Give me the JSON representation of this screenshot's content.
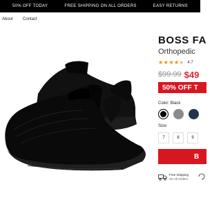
{
  "promo_bar": {
    "items": [
      "50% OFF TODAY",
      "FREE SHIPPING ON ALL ORDERS",
      "EASY RETURNS"
    ]
  },
  "nav": {
    "about": "About",
    "contact": "Contact"
  },
  "product": {
    "title": "BOSS FA",
    "subtitle": "Orthopedic",
    "rating": "4.7",
    "rating_stars": 4.5,
    "old_price": "$99.99",
    "new_price": "$49",
    "discount_badge": "50% OFF T",
    "color_label": "Color: Black",
    "colors": [
      {
        "name": "Black",
        "hex": "#000000"
      },
      {
        "name": "Grey",
        "hex": "#8a8a8a"
      },
      {
        "name": "Navy",
        "hex": "#25354f"
      }
    ],
    "size_label": "Size:",
    "sizes": [
      "7",
      "8",
      "9"
    ],
    "add_button_label": "B",
    "shipping_line1": "Free Shipping",
    "shipping_line2": "On All Orders"
  },
  "colors": {
    "promo_bg": "#000000",
    "accent_red": "#d7171f",
    "price_red": "#e1222d",
    "star_orange": "#ef8a00"
  }
}
